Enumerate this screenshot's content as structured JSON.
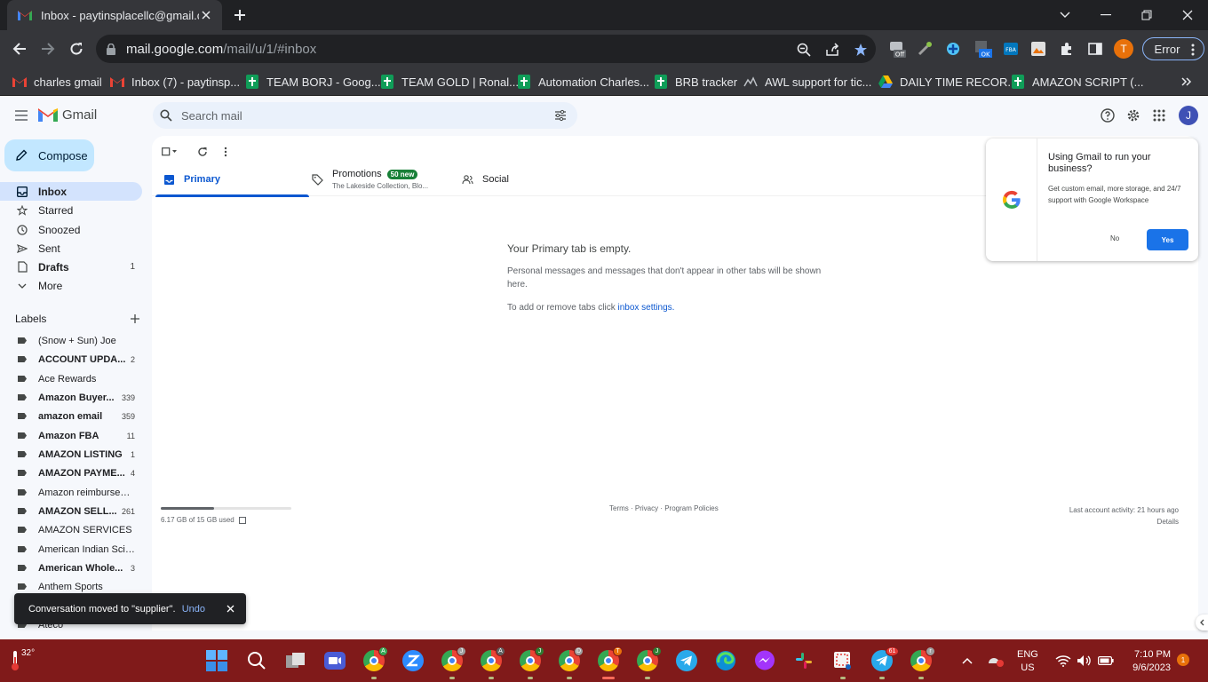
{
  "browser": {
    "tab_title": "Inbox - paytinsplacellc@gmail.com",
    "url_host": "mail.google.com",
    "url_path": "/mail/u/1/#inbox",
    "error_label": "Error",
    "profile_initial": "T"
  },
  "bookmarks": [
    {
      "label": "charles gmail"
    },
    {
      "label": "Inbox (7) - paytinsp..."
    },
    {
      "label": "TEAM BORJ - Goog..."
    },
    {
      "label": "TEAM GOLD | Ronal..."
    },
    {
      "label": "Automation Charles..."
    },
    {
      "label": "BRB tracker"
    },
    {
      "label": "AWL support for tic..."
    },
    {
      "label": "DAILY TIME RECOR..."
    },
    {
      "label": "AMAZON SCRIPT (..."
    }
  ],
  "gmail": {
    "brand": "Gmail",
    "search_placeholder": "Search mail",
    "avatar_initial": "J",
    "compose_label": "Compose"
  },
  "nav": [
    {
      "label": "Inbox",
      "count": ""
    },
    {
      "label": "Starred",
      "count": ""
    },
    {
      "label": "Snoozed",
      "count": ""
    },
    {
      "label": "Sent",
      "count": ""
    },
    {
      "label": "Drafts",
      "count": "1"
    },
    {
      "label": "More",
      "count": ""
    }
  ],
  "labels_heading": "Labels",
  "labels": [
    {
      "label": "(Snow + Sun) Joe",
      "count": ""
    },
    {
      "label": "ACCOUNT UPDA...",
      "count": "2"
    },
    {
      "label": "Ace Rewards",
      "count": ""
    },
    {
      "label": "Amazon Buyer...",
      "count": "339"
    },
    {
      "label": "amazon email",
      "count": "359"
    },
    {
      "label": "Amazon FBA",
      "count": "11"
    },
    {
      "label": "AMAZON LISTING",
      "count": "1"
    },
    {
      "label": "AMAZON PAYME...",
      "count": "4"
    },
    {
      "label": "Amazon reimbursem...",
      "count": ""
    },
    {
      "label": "AMAZON SELL...",
      "count": "261"
    },
    {
      "label": "AMAZON SERVICES",
      "count": ""
    },
    {
      "label": "American Indian Scie...",
      "count": ""
    },
    {
      "label": "American Whole...",
      "count": "3"
    },
    {
      "label": "Anthem Sports",
      "count": ""
    },
    {
      "label": "Ateco",
      "count": ""
    }
  ],
  "inbox_tabs": {
    "primary": "Primary",
    "promotions": "Promotions",
    "promotions_badge": "50 new",
    "promotions_sub": "The Lakeside Collection, Blo...",
    "social": "Social"
  },
  "empty_state": {
    "heading": "Your Primary tab is empty.",
    "body": "Personal messages and messages that don't appear in other tabs will be shown here.",
    "settings_prefix": "To add or remove tabs click ",
    "settings_link": "inbox settings."
  },
  "footer": {
    "storage_text": "6.17 GB of 15 GB used",
    "storage_fraction": 0.411,
    "links": "Terms · Privacy · Program Policies",
    "activity": "Last account activity: 21 hours ago",
    "details": "Details"
  },
  "promo_card": {
    "title": "Using Gmail to run your business?",
    "body": "Get custom email, more storage, and 24/7 support with Google Workspace",
    "no": "No",
    "yes": "Yes"
  },
  "snackbar": {
    "message": "Conversation moved to \"supplier\".",
    "undo": "Undo"
  },
  "taskbar": {
    "weather_temp": "32°",
    "lang_top": "ENG",
    "lang_bottom": "US",
    "time": "7:10 PM",
    "date": "9/6/2023",
    "notif_count": "1",
    "telegram_badge": "61"
  }
}
